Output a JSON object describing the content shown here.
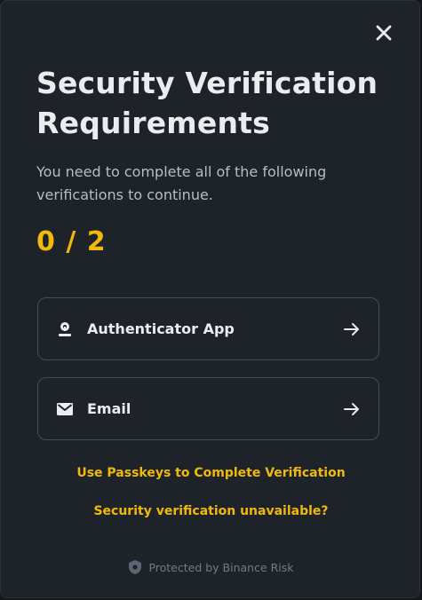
{
  "dialog": {
    "title": "Security Verification Requirements",
    "subtitle": "You need to complete all of the following verifications to continue.",
    "progress": "0 / 2",
    "close_icon": "close-icon"
  },
  "options": [
    {
      "label": "Authenticator App",
      "icon": "authenticator-icon",
      "arrow_icon": "arrow-right-icon"
    },
    {
      "label": "Email",
      "icon": "envelope-icon",
      "arrow_icon": "arrow-right-icon"
    }
  ],
  "links": {
    "passkeys": "Use Passkeys to Complete Verification",
    "unavailable": "Security verification unavailable?"
  },
  "footer": {
    "text": "Protected by Binance Risk",
    "icon": "shield-icon"
  },
  "colors": {
    "background": "#1e2329",
    "accent": "#f0b90b",
    "text_primary": "#eaecef",
    "text_secondary": "#b7bdc6",
    "border": "#474d57",
    "muted": "#707a8a"
  }
}
